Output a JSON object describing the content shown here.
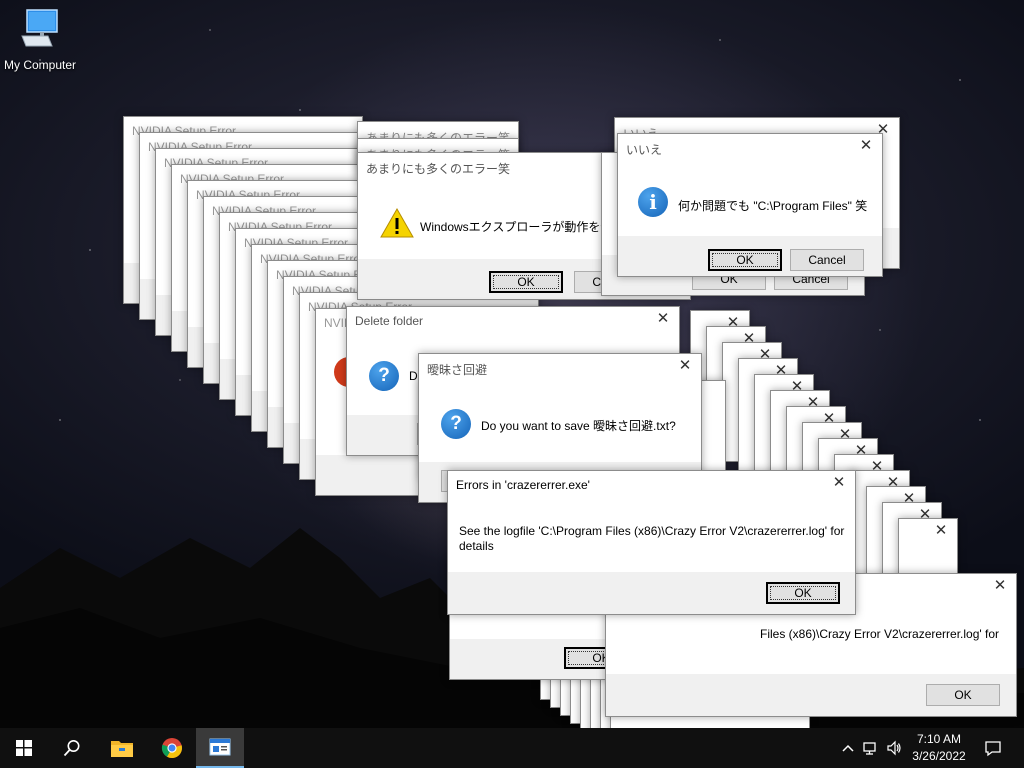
{
  "desktop": {
    "icon_label": "My Computer"
  },
  "nvidia_stack": {
    "title": "NVIDIA Setup Error",
    "titles": [
      "NVIDIA Setup Error",
      "NVIDIA Setup Error",
      "NVIDIA Setup Error",
      "NVIDIA Setup Error",
      "NVIDIA Setup Error",
      "NVIDIA Setup Error",
      "NVIDIA Setup Error",
      "NVIDIA Setup Error",
      "NVIDIA Setup Error",
      "NVIDIA Setup Error",
      "NVIDIA Setup Error",
      "NVIDIA Setup Error",
      "NVIDIA Setup Error"
    ]
  },
  "japanese_errors": {
    "title": "あまりにも多くのエラー笑",
    "message": "Windowsエクスプローラが動作を停止しました",
    "ok_label": "OK",
    "cancel_label": "Cancel"
  },
  "iie_dialog": {
    "title": "いいえ",
    "message": "何か問題でも \"C:\\Program Files\" 笑",
    "ok_label": "OK",
    "cancel_label": "Cancel"
  },
  "delete_folder": {
    "title": "Delete folder",
    "message_prefix": "D"
  },
  "save_dialog": {
    "title": "曖昧さ回避",
    "message": "Do you want to save 曖昧さ回避.txt?"
  },
  "crazy_error": {
    "title": "Errors in 'crazererrer.exe'",
    "message_line1": "See the logfile 'C:\\Program Files (x86)\\Crazy Error V2\\crazererrer.log' for",
    "message_line2": "details",
    "ok_label": "OK"
  },
  "crazy_error_behind": {
    "ok_label": "OK"
  },
  "crazy_error_right": {
    "message": "Files (x86)\\Crazy Error V2\\crazererrer.log' for",
    "ok_label": "OK"
  },
  "taskbar": {
    "time": "7:10 AM",
    "date": "3/26/2022"
  }
}
